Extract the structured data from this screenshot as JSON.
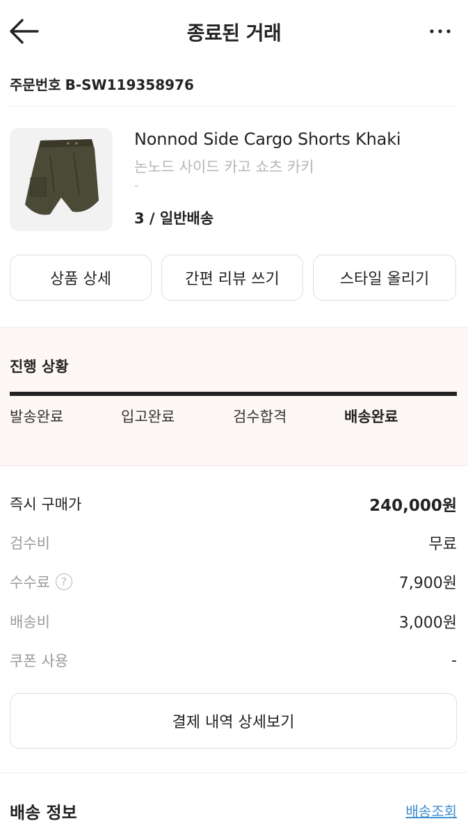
{
  "header": {
    "title": "종료된 거래"
  },
  "order": {
    "label": "주문번호",
    "number": "B-SW119358976"
  },
  "product": {
    "name_en": "Nonnod Side Cargo Shorts Khaki",
    "name_ko": "논노드 사이드 카고 쇼츠 카키",
    "extra": "-",
    "option": "3 / 일반배송"
  },
  "actions": {
    "detail": "상품 상세",
    "review": "간편 리뷰 쓰기",
    "style": "스타일 올리기"
  },
  "progress": {
    "title": "진행 상황",
    "steps": [
      "발송완료",
      "입고완료",
      "검수합격",
      "배송완료"
    ],
    "active_step": "배송완료"
  },
  "pricing": {
    "purchase_label": "즉시 구매가",
    "purchase_value": "240,000원",
    "inspection_label": "검수비",
    "inspection_value": "무료",
    "fee_label": "수수료",
    "fee_value": "7,900원",
    "shipping_label": "배송비",
    "shipping_value": "3,000원",
    "coupon_label": "쿠폰 사용",
    "coupon_value": "-"
  },
  "payment_button": "결제 내역 상세보기",
  "shipping": {
    "title": "배송 정보",
    "tracking_link": "배송조회"
  },
  "colors": {
    "accent_link": "#3d8fd4",
    "progress_bg": "#fdf8f6",
    "progress_bar": "#222222"
  }
}
